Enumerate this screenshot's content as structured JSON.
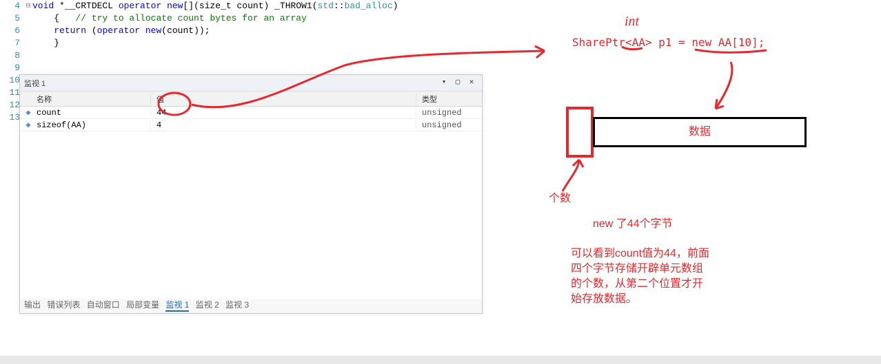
{
  "code": {
    "lines": [
      {
        "num": "4",
        "fold": "⊟",
        "tokens": [
          {
            "c": "kw",
            "t": "void"
          },
          {
            "c": "punct",
            "t": " *"
          },
          {
            "c": "ident",
            "t": "__CRTDECL "
          },
          {
            "c": "kw",
            "t": "operator"
          },
          {
            "c": "punct",
            "t": " "
          },
          {
            "c": "kw",
            "t": "new"
          },
          {
            "c": "punct",
            "t": "[]("
          },
          {
            "c": "ident",
            "t": "size_t count"
          },
          {
            "c": "punct",
            "t": ") "
          },
          {
            "c": "ident",
            "t": "_THROW1"
          },
          {
            "c": "punct",
            "t": "("
          },
          {
            "c": "type",
            "t": "std"
          },
          {
            "c": "punct",
            "t": "::"
          },
          {
            "c": "type",
            "t": "bad_alloc"
          },
          {
            "c": "punct",
            "t": ")"
          }
        ]
      },
      {
        "num": "5",
        "fold": "",
        "tokens": [
          {
            "c": "punct",
            "t": "    {   "
          },
          {
            "c": "comment",
            "t": "// try to allocate count bytes for an array"
          }
        ]
      },
      {
        "num": "6",
        "fold": "",
        "tokens": [
          {
            "c": "punct",
            "t": "    "
          },
          {
            "c": "kw",
            "t": "return"
          },
          {
            "c": "punct",
            "t": " ("
          },
          {
            "c": "kw",
            "t": "operator"
          },
          {
            "c": "punct",
            "t": " "
          },
          {
            "c": "kw",
            "t": "new"
          },
          {
            "c": "punct",
            "t": "(count));"
          }
        ]
      },
      {
        "num": "7",
        "fold": "",
        "tokens": [
          {
            "c": "punct",
            "t": "    }"
          }
        ]
      },
      {
        "num": "8",
        "fold": "",
        "tokens": []
      },
      {
        "num": "9",
        "fold": "",
        "tokens": []
      },
      {
        "num": "10",
        "fold": "",
        "tokens": []
      },
      {
        "num": "11",
        "fold": "",
        "tokens": []
      },
      {
        "num": "12",
        "fold": "",
        "tokens": []
      },
      {
        "num": "13",
        "fold": "",
        "tokens": []
      }
    ]
  },
  "watch": {
    "title": "监视 1",
    "headers": {
      "name": "名称",
      "value": "值",
      "type": "类型"
    },
    "rows": [
      {
        "name": "count",
        "value": "44",
        "type": "unsigned"
      },
      {
        "name": "sizeof(AA)",
        "value": "4",
        "type": "unsigned"
      }
    ],
    "tabs": {
      "output": "输出",
      "errorList": "错误列表",
      "autos": "自动窗口",
      "locals": "局部变量",
      "watch1": "监视 1",
      "watch2": "监视 2",
      "watch3": "监视 3"
    }
  },
  "annotations": {
    "int_label": "int",
    "code_snippet": "SharePtr<AA> p1 = new AA[10];",
    "data_label": "数据",
    "count_label": "个数",
    "line1": "new 了44个字节",
    "para": "可以看到count值为44，前面\n四个字节存储开辟单元数组\n的个数，从第二个位置才开\n始存放数据。"
  }
}
